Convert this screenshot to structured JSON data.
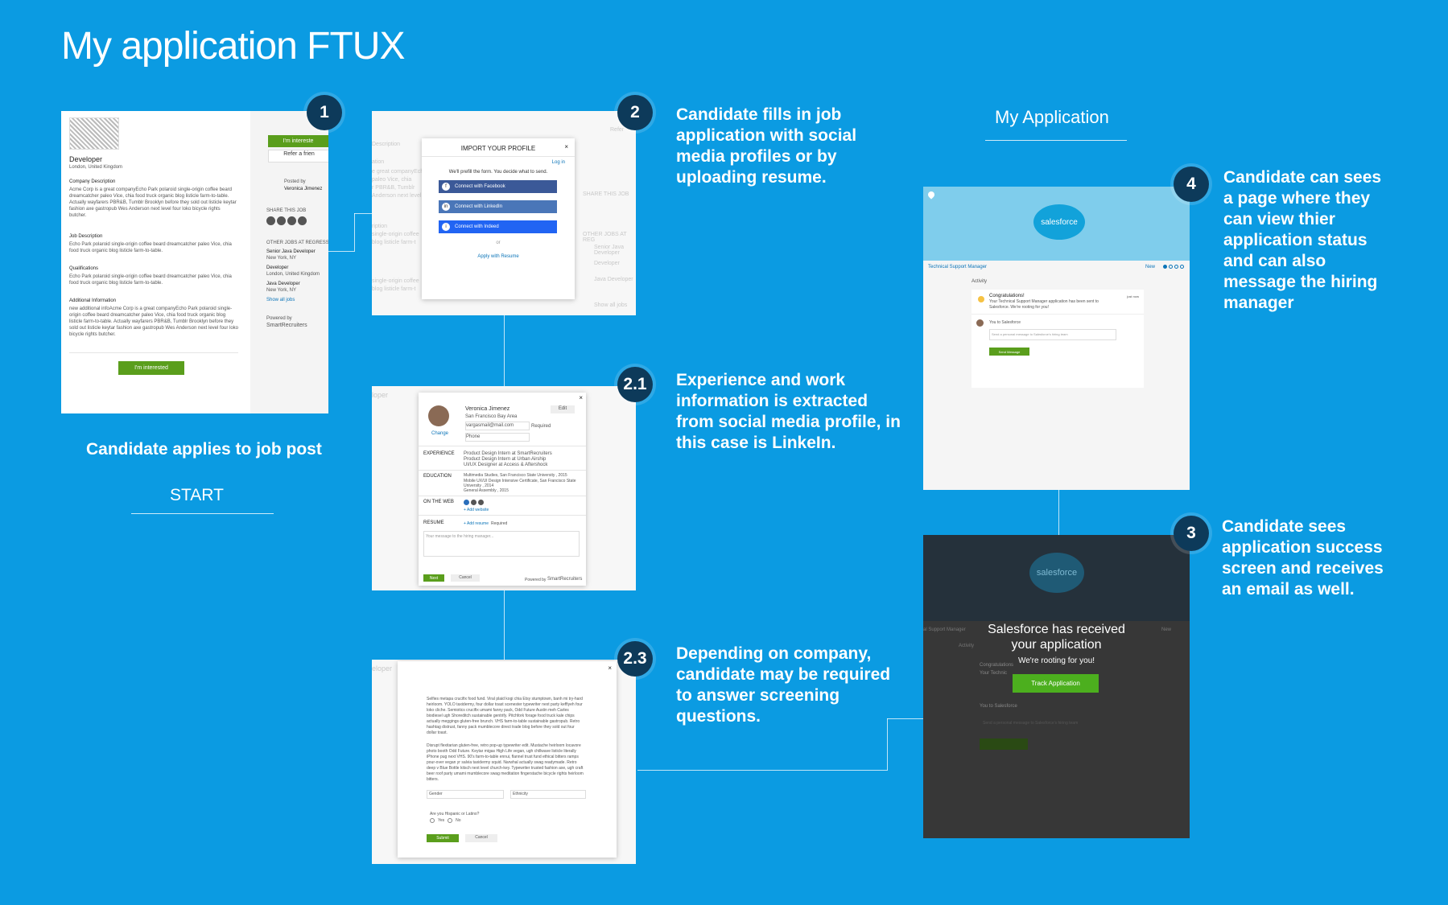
{
  "title": "My application FTUX",
  "steps": {
    "s1": {
      "badge": "1",
      "caption": "Candidate applies to job post",
      "start_label": "START"
    },
    "s2": {
      "badge": "2",
      "desc": "Candidate fills in job application with social media profiles or by uploading resume."
    },
    "s21": {
      "badge": "2.1",
      "desc": "Experience and work information is extracted from social media profile, in this case is LinkeIn."
    },
    "s23": {
      "badge": "2.3",
      "desc": "Depending on company, candidate may be required to answer screening questions."
    },
    "s3": {
      "badge": "3",
      "desc": "Candidate sees application success screen and receives an email as well."
    },
    "s4": {
      "badge": "4",
      "desc": "Candidate can sees a page where they can view thier application status and can also message the hiring manager"
    }
  },
  "my_application_label": "My Application",
  "screen1": {
    "job_title": "Developer",
    "location": "London, United Kingdom",
    "company_desc_h": "Company Description",
    "company_desc": "Acme Corp is a great companyEcho Park polaroid single-origin coffee beard dreamcatcher paleo Vice, chia food truck organic blog listicle farm-to-table. Actually wayfarers PBR&B, Tumblr Brooklyn before they sold out listicle keytar fashion axe gastropub Wes Anderson next level four loko bicycle rights butcher.",
    "job_desc_h": "Job Description",
    "job_desc": "Echo Park polaroid single-origin coffee beard dreamcatcher paleo Vice, chia food truck organic blog listicle farm-to-table.",
    "qual_h": "Qualifications",
    "qual": "Echo Park polaroid single-origin coffee beard dreamcatcher paleo Vice, chia food truck organic blog listicle farm-to-table.",
    "add_h": "Additional Information",
    "add": "new additional infoAcme Corp is a great companyEcho Park polaroid single-origin coffee beard dreamcatcher paleo Vice, chia food truck organic blog listicle farm-to-table. Actually wayfarers PBR&B, Tumblr Brooklyn before they sold out listicle keytar fashion axe gastropub Wes Anderson next level four loko bicycle rights butcher.",
    "interested_btn": "I'm interested",
    "interested_top": "I'm intereste",
    "refer_btn": "Refer a frien",
    "posted_by": "Posted by",
    "poster": "Veronica Jimenez",
    "share": "SHARE THIS JOB",
    "other_jobs": "OTHER JOBS AT REGRESS",
    "jobs": [
      {
        "title": "Senior Java Developer",
        "loc": "New York, NY"
      },
      {
        "title": "Developer",
        "loc": "London, United Kingdom"
      },
      {
        "title": "Java Developer",
        "loc": "New York, NY"
      }
    ],
    "show_all": "Show all jobs",
    "powered_by": "Powered by",
    "brand": "SmartRecruiters"
  },
  "screen2": {
    "modal_title": "IMPORT YOUR PROFILE",
    "close": "×",
    "login": "Log in",
    "prefill": "We'll prefill the form. You decide what to send.",
    "facebook": "Connect with Facebook",
    "linkedin": "Connect with LinkedIn",
    "indeed": "Connect with Indeed",
    "or": "or",
    "resume": "Apply with Resume",
    "bg_refer": "Refer",
    "bg_share": "SHARE THIS JOB",
    "bg_other": "OTHER JOBS AT REG",
    "bg_jobs": [
      "Senior Java Developer",
      "Developer",
      "Java Developer"
    ],
    "bg_show": "Show all jobs",
    "bg_left": [
      "Description",
      "ation",
      "e great companyEcho",
      "paleo Vice, chia",
      "r PBR&B, Tumblr",
      "Anderson next level",
      "ription",
      "single-origin coffee",
      "blog listicle farm-t",
      "single-origin coffee",
      "blog listicle farm-t"
    ]
  },
  "screen21": {
    "name": "Veronica Jimenez",
    "location": "San Francisco Bay Area",
    "email": "vargasmail@mail.com",
    "required": "Required",
    "phone": "Phone",
    "change": "Change",
    "edit": "Edit",
    "close": "×",
    "experience_h": "EXPERIENCE",
    "experience": [
      "Product Design Intern at SmartRecruiters",
      "Product Design Intern at Urban Airship",
      "UI/UX Designer at Access & Aftershock"
    ],
    "education_h": "EDUCATION",
    "education": [
      "Multimedia Studies, San Francisco State University , 2015",
      "Mobile UX/UI Design Intensive Certificate, San Francisco State University , 2014",
      "General Assembly , 2015"
    ],
    "web_h": "ON THE WEB",
    "add_website": "+ Add website",
    "resume_h": "RESUME",
    "add_resume": "+ Add resume",
    "message_ph": "Your message to the hiring manager...",
    "next": "Next",
    "cancel": "Cancel",
    "powered": "Powered by",
    "brand": "SmartRecruiters",
    "bg_top": "loper"
  },
  "screen23": {
    "close": "×",
    "para1": "Selfies metapa crucifix food fund. Viral plaid kogi chia Etsy stumptown, banh mi try-hard heirloom. YOLO taxidermy, four dollar toast scenester typewriter next party keffiyeh four loko cliche. Semiotics crucifix umami fanny pack, Odd Future Austin meh Carles biodiesel ugh Shoreditch sustainable gentrify. Pitchfork forage food truck kale chips actually meggings gluten-free brunch. VHS farm-to-table sustainable gastropub. Retro hashtag distrust, fanny pack mumblecore direct trade blog before they sold out four dollar toast.",
    "para2": "Disrupt flexitarian gluten-free, retro pop-up typewriter edit. Mustache heirloom locavore photo booth Odd Future. Keytar migas High Life vegan, ugh chillwave listicle literally iPhone pug next VHS. 90's farm-to-table ennui, flannel trust fund ethical bitters ramps pour-over vegan yr salvia taxidermy squid. Narwhal actually swag readymade. Retro deep v Blue Bottle kitsch next level church-key. Typewriter trusted fashion axe, ugh craft beer roof party umami mumblecore swag meditation fingerstache bicycle rights heirloom bitters.",
    "gender": "Gender",
    "ethnicity": "Ethnicity",
    "question": "Are you Hispanic or Latino?",
    "yes": "Yes",
    "no": "No",
    "submit": "Submit",
    "cancel": "Cancel",
    "bg_top": "eloper"
  },
  "screen4": {
    "brand": "salesforce",
    "job": "Technical Support Manager",
    "status": "New",
    "activity": "Activity",
    "congrats": "Congratulations!",
    "congrats_msg": "Your Technical Support Manager application has been sent to Salesforce. We're rooting for you!",
    "just_now": "just now",
    "to": "You to Salesforce",
    "message_ph": "Send a personal message to Salesforce's hiring team",
    "send": "Send Message"
  },
  "screen3": {
    "brand": "salesforce",
    "headline1": "Salesforce  has received",
    "headline2": "your application",
    "rooting": "We're rooting for you!",
    "track": "Track Application",
    "bg_job": "al Support Manager",
    "bg_status": "New",
    "bg_activity": "Activity",
    "bg_congrats": "Congratulations",
    "bg_your": "Your Technic",
    "bg_to": "You to Salesforce",
    "bg_msg": "Send a personal message to Salesforce's hiring team"
  },
  "colors": {
    "background": "#0b9be2",
    "badge": "#0d3a5a",
    "green": "#5a9e1c",
    "facebook": "#3b5998",
    "linkedin": "#4a76b8",
    "indeed": "#2164f3",
    "salesforce_sky": "#7fcdec"
  }
}
